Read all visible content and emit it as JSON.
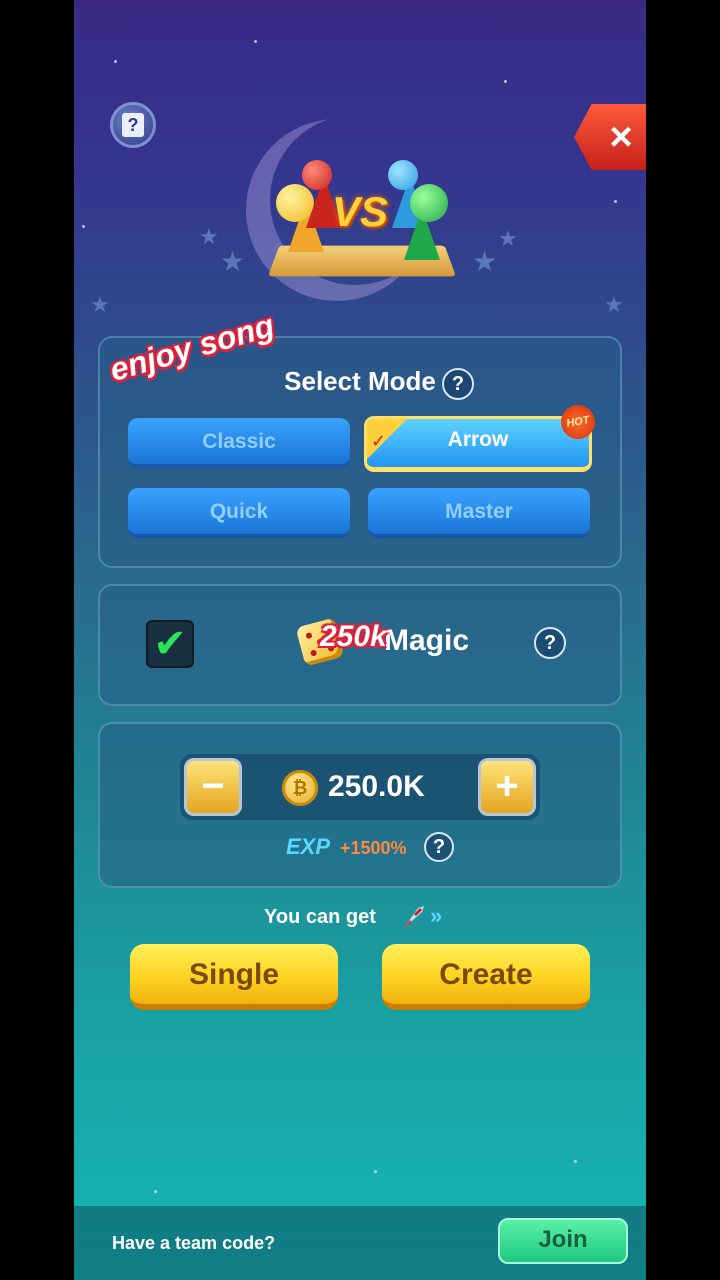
{
  "header": {
    "help_icon": "question-card-icon",
    "close_icon": "close-x-icon",
    "close_label": "×",
    "vs_label": "VS"
  },
  "overlay_stamp": "enjoy song",
  "mode_panel": {
    "title": "Select Mode",
    "help_label": "?",
    "modes": [
      {
        "label": "Classic",
        "selected": false
      },
      {
        "label": "Arrow",
        "selected": true,
        "badge": "HOT"
      },
      {
        "label": "Quick",
        "selected": false
      },
      {
        "label": "Master",
        "selected": false
      }
    ],
    "selected_check": "✓"
  },
  "magic_panel": {
    "checkbox_checked": true,
    "check_glyph": "✔",
    "label": "Magic",
    "overlay_stamp": "250k",
    "help_label": "?"
  },
  "bet_panel": {
    "minus_label": "−",
    "plus_label": "+",
    "coin_glyph": "₿",
    "value": "250.0K",
    "exp_label": "EXP",
    "exp_value": "+1500%",
    "help_label": "?"
  },
  "reward": {
    "text": "You can get",
    "arrow": "»"
  },
  "actions": {
    "single": "Single",
    "create": "Create"
  },
  "footer": {
    "team_code_label": "Have a team code?",
    "join": "Join"
  },
  "colors": {
    "accent_yellow": "#ffd321",
    "mode_blue": "#1a74d6",
    "join_green": "#1ec981",
    "close_red": "#c4201a"
  }
}
